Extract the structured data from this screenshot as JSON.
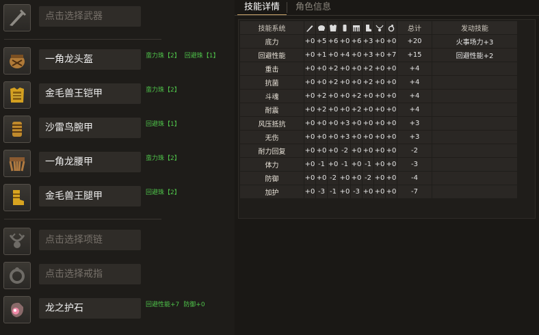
{
  "left_panel": {
    "slots": [
      {
        "id": "weapon",
        "name": "点击选择武器",
        "empty": true,
        "icon": "weapon-placeholder-icon",
        "jewels": []
      },
      {
        "id": "helm",
        "name": "一角龙头盔",
        "empty": false,
        "icon": "helmet-icon",
        "jewels": [
          "蛮力珠【2】",
          "回避珠【1】"
        ]
      },
      {
        "id": "chest",
        "name": "金毛兽王铠甲",
        "empty": false,
        "icon": "chest-armor-icon",
        "jewels": [
          "蛮力珠【2】"
        ]
      },
      {
        "id": "arms",
        "name": "沙雷鸟腕甲",
        "empty": false,
        "icon": "arm-guard-icon",
        "jewels": [
          "回避珠【1】"
        ]
      },
      {
        "id": "waist",
        "name": "一角龙腰甲",
        "empty": false,
        "icon": "waist-armor-icon",
        "jewels": [
          "蛮力珠【2】"
        ]
      },
      {
        "id": "legs",
        "name": "金毛兽王腿甲",
        "empty": false,
        "icon": "leg-armor-icon",
        "jewels": [
          "回避珠【2】"
        ]
      },
      {
        "id": "necklace",
        "name": "点击选择项链",
        "empty": true,
        "icon": "necklace-placeholder-icon",
        "jewels": []
      },
      {
        "id": "ring",
        "name": "点击选择戒指",
        "empty": true,
        "icon": "ring-placeholder-icon",
        "jewels": []
      },
      {
        "id": "talisman",
        "name": "龙之护石",
        "empty": false,
        "icon": "talisman-icon",
        "jewels": [
          "回避性能+7",
          "防御+0"
        ]
      }
    ]
  },
  "tabs": [
    {
      "label": "技能详情",
      "active": true
    },
    {
      "label": "角色信息",
      "active": false
    }
  ],
  "skill_table": {
    "headers": {
      "name": "技能系统",
      "parts": [
        "weapon-icon",
        "helmet-icon",
        "chest-armor-icon",
        "arm-guard-icon",
        "waist-armor-icon",
        "leg-armor-icon",
        "necklace-icon",
        "ring-icon"
      ],
      "total": "总计",
      "activated": "发动技能"
    },
    "rows": [
      {
        "name": "底力",
        "values": [
          "+0",
          "+5",
          "+6",
          "+0",
          "+6",
          "+3",
          "+0",
          "+0"
        ],
        "total": "+20",
        "activated": "火事场力+3"
      },
      {
        "name": "回避性能",
        "values": [
          "+0",
          "+1",
          "+0",
          "+4",
          "+0",
          "+3",
          "+0",
          "+7"
        ],
        "total": "+15",
        "activated": "回避性能+2"
      },
      {
        "name": "重击",
        "values": [
          "+0",
          "+0",
          "+2",
          "+0",
          "+0",
          "+2",
          "+0",
          "+0"
        ],
        "total": "+4",
        "activated": ""
      },
      {
        "name": "抗菌",
        "values": [
          "+0",
          "+0",
          "+2",
          "+0",
          "+0",
          "+2",
          "+0",
          "+0"
        ],
        "total": "+4",
        "activated": ""
      },
      {
        "name": "斗魂",
        "values": [
          "+0",
          "+2",
          "+0",
          "+0",
          "+2",
          "+0",
          "+0",
          "+0"
        ],
        "total": "+4",
        "activated": ""
      },
      {
        "name": "耐震",
        "values": [
          "+0",
          "+2",
          "+0",
          "+0",
          "+2",
          "+0",
          "+0",
          "+0"
        ],
        "total": "+4",
        "activated": ""
      },
      {
        "name": "风压抵抗",
        "values": [
          "+0",
          "+0",
          "+0",
          "+3",
          "+0",
          "+0",
          "+0",
          "+0"
        ],
        "total": "+3",
        "activated": ""
      },
      {
        "name": "无伤",
        "values": [
          "+0",
          "+0",
          "+0",
          "+3",
          "+0",
          "+0",
          "+0",
          "+0"
        ],
        "total": "+3",
        "activated": ""
      },
      {
        "name": "耐力回复",
        "values": [
          "+0",
          "+0",
          "+0",
          "-2",
          "+0",
          "+0",
          "+0",
          "+0"
        ],
        "total": "-2",
        "activated": ""
      },
      {
        "name": "体力",
        "values": [
          "+0",
          "-1",
          "+0",
          "-1",
          "+0",
          "-1",
          "+0",
          "+0"
        ],
        "total": "-3",
        "activated": ""
      },
      {
        "name": "防御",
        "values": [
          "+0",
          "+0",
          "-2",
          "+0",
          "+0",
          "-2",
          "+0",
          "+0"
        ],
        "total": "-4",
        "activated": ""
      },
      {
        "name": "加护",
        "values": [
          "+0",
          "-3",
          "-1",
          "+0",
          "-3",
          "+0",
          "+0",
          "+0"
        ],
        "total": "-7",
        "activated": ""
      }
    ]
  }
}
